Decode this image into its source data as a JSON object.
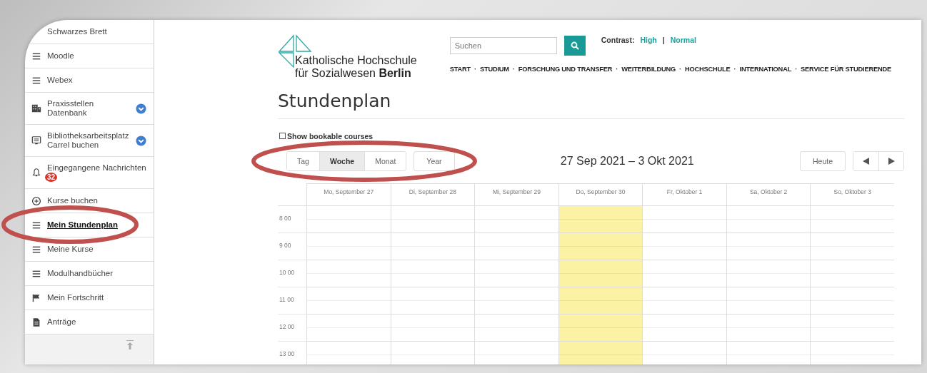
{
  "sidebar": {
    "items": [
      {
        "label": "Schwarzes Brett",
        "selected": false,
        "expandable": false
      },
      {
        "label": "Moodle",
        "selected": false,
        "expandable": false
      },
      {
        "label": "Webex",
        "selected": false,
        "expandable": false
      },
      {
        "label": "Praxisstellen Datenbank",
        "selected": false,
        "expandable": true
      },
      {
        "label": "Bibliotheksarbeitsplatz Carrel buchen",
        "selected": false,
        "expandable": true
      },
      {
        "label": "Eingegangene Nachrichten",
        "selected": false,
        "expandable": false,
        "badge": "32"
      },
      {
        "label": "Kurse buchen",
        "selected": false,
        "expandable": false
      },
      {
        "label": "Mein Stundenplan",
        "selected": true,
        "expandable": false
      },
      {
        "label": "Meine Kurse",
        "selected": false,
        "expandable": false
      },
      {
        "label": "Modulhandbücher",
        "selected": false,
        "expandable": false
      },
      {
        "label": "Mein Fortschritt",
        "selected": false,
        "expandable": false
      },
      {
        "label": "Anträge",
        "selected": false,
        "expandable": false
      }
    ]
  },
  "logo": {
    "line_1": "Katholische Hochschule",
    "line_2": "für Sozialwesen **Berlin**"
  },
  "search": {
    "placeholder": "Suchen"
  },
  "contrast": {
    "label": "Contrast:",
    "options": [
      "High",
      "Normal"
    ],
    "divider": "|"
  },
  "nav": {
    "separator": "·",
    "items": [
      "START",
      "STUDIUM",
      "FORSCHUNG UND TRANSFER",
      "WEITERBILDUNG",
      "HOCHSCHULE",
      "INTERNATIONAL",
      "SERVICE FÜR STUDIERENDE"
    ]
  },
  "page_title": "Stundenplan",
  "bookable": {
    "label": "Show bookable courses",
    "checked": false
  },
  "views": [
    {
      "label": "Tag",
      "selected": false
    },
    {
      "label": "Woche",
      "selected": true
    },
    {
      "label": "Monat",
      "selected": false
    }
  ],
  "year_button": "Year",
  "range": "27 Sep 2021 – 3 Okt 2021",
  "today_button": "Heute",
  "days": [
    {
      "label": "Mo, September 27",
      "today": false
    },
    {
      "label": "Di, September 28",
      "today": false
    },
    {
      "label": "Mi, September 29",
      "today": false
    },
    {
      "label": "Do, September 30",
      "today": true
    },
    {
      "label": "Fr, Oktober 1",
      "today": false
    },
    {
      "label": "Sa, Oktober 2",
      "today": false
    },
    {
      "label": "So, Oktober 3",
      "today": false
    }
  ],
  "hours": [
    "8 00",
    "9 00",
    "10 00",
    "11 00",
    "12 00",
    "13 00"
  ]
}
